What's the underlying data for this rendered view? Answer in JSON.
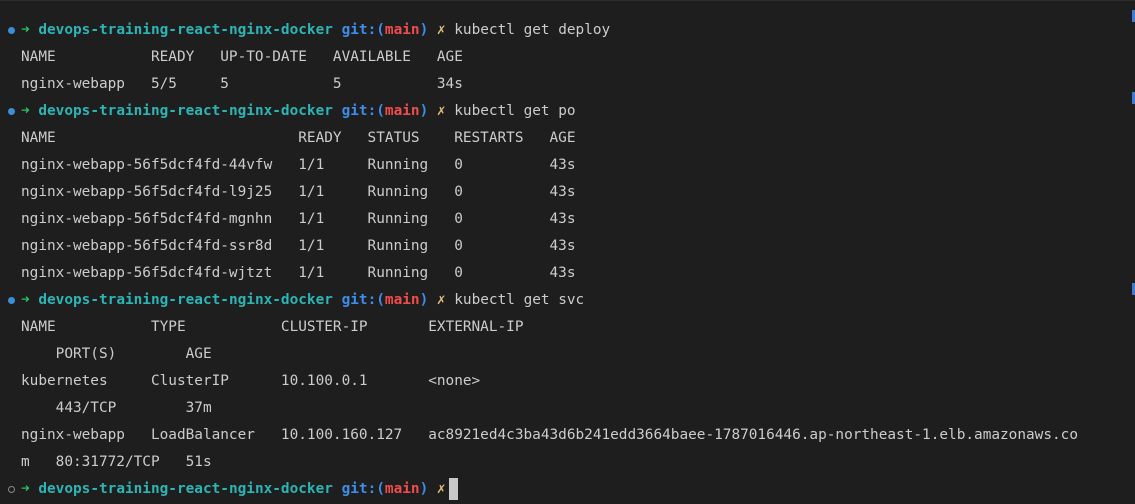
{
  "prompt": {
    "arrow": "➜",
    "dir": "devops-training-react-nginx-docker",
    "git_open": "git:(",
    "branch": "main",
    "git_close": ")",
    "dirty": "✗"
  },
  "lines": [
    {
      "type": "prompt",
      "dot": "filled",
      "cmd": "kubectl get deploy"
    },
    {
      "type": "out",
      "text": "NAME           READY   UP-TO-DATE   AVAILABLE   AGE"
    },
    {
      "type": "out",
      "text": "nginx-webapp   5/5     5            5           34s"
    },
    {
      "type": "prompt",
      "dot": "filled",
      "cmd": "kubectl get po"
    },
    {
      "type": "out",
      "text": "NAME                            READY   STATUS    RESTARTS   AGE"
    },
    {
      "type": "out",
      "text": "nginx-webapp-56f5dcf4fd-44vfw   1/1     Running   0          43s"
    },
    {
      "type": "out",
      "text": "nginx-webapp-56f5dcf4fd-l9j25   1/1     Running   0          43s"
    },
    {
      "type": "out",
      "text": "nginx-webapp-56f5dcf4fd-mgnhn   1/1     Running   0          43s"
    },
    {
      "type": "out",
      "text": "nginx-webapp-56f5dcf4fd-ssr8d   1/1     Running   0          43s"
    },
    {
      "type": "out",
      "text": "nginx-webapp-56f5dcf4fd-wjtzt   1/1     Running   0          43s"
    },
    {
      "type": "prompt",
      "dot": "filled",
      "cmd": "kubectl get svc"
    },
    {
      "type": "out",
      "text": "NAME           TYPE           CLUSTER-IP       EXTERNAL-IP"
    },
    {
      "type": "out",
      "text": "    PORT(S)        AGE"
    },
    {
      "type": "out",
      "text": "kubernetes     ClusterIP      10.100.0.1       <none>"
    },
    {
      "type": "out",
      "text": "    443/TCP        37m"
    },
    {
      "type": "out",
      "text": "nginx-webapp   LoadBalancer   10.100.160.127   ac8921ed4c3ba43d6b241edd3664baee-1787016446.ap-northeast-1.elb.amazonaws.co"
    },
    {
      "type": "out",
      "text": "m   80:31772/TCP   51s"
    },
    {
      "type": "prompt",
      "dot": "hollow",
      "cmd": "",
      "cursor": true
    }
  ],
  "colors": {
    "background": "#1e1e1e",
    "text": "#cccccc",
    "arrow": "#22c55e",
    "dir": "#2bb5b5",
    "git": "#3b8eea",
    "branch": "#f14c4c",
    "dirty": "#e5c07b"
  }
}
